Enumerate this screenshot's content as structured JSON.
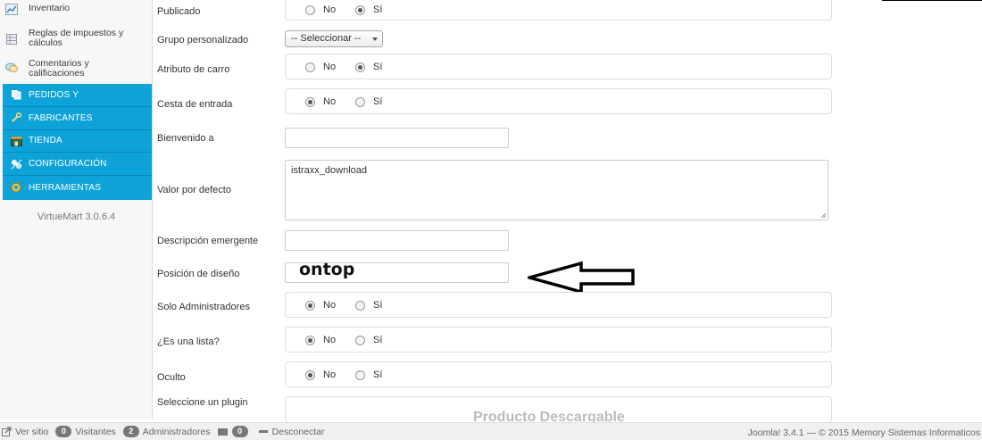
{
  "sidebar": {
    "top_items": [
      {
        "label": "Inventario",
        "icon": "chart-icon"
      },
      {
        "label": "Reglas de impuestos y cálculos",
        "icon": "table-icon"
      },
      {
        "label": "Comentarios y calificaciones",
        "icon": "comment-icon"
      }
    ],
    "menu_items": [
      {
        "label": "PEDIDOS Y",
        "icon": "copy-icon"
      },
      {
        "label": "FABRICANTES",
        "icon": "wrench-icon"
      },
      {
        "label": "TIENDA",
        "icon": "store-icon"
      },
      {
        "label": "CONFIGURACIÓN",
        "icon": "config-icon"
      },
      {
        "label": "HERRAMIENTAS",
        "icon": "tools-icon"
      }
    ],
    "version": "VirtueMart 3.0.6.4",
    "accent_color": "#0ea3d8"
  },
  "form": {
    "publicado": {
      "label": "Publicado",
      "no": "No",
      "si": "Sí",
      "selected": "si"
    },
    "grupo": {
      "label": "Grupo personalizado",
      "select_value": "-- Seleccionar --"
    },
    "atributo": {
      "label": "Atributo de carro",
      "no": "No",
      "si": "Sí",
      "selected": "si"
    },
    "cesta": {
      "label": "Cesta de entrada",
      "no": "No",
      "si": "Sí",
      "selected": "no"
    },
    "bienvenido": {
      "label": "Bienvenido a",
      "value": ""
    },
    "valor": {
      "label": "Valor por defecto",
      "value": "istraxx_download"
    },
    "descripcion": {
      "label": "Descripción emergente",
      "value": ""
    },
    "posicion": {
      "label": "Posición de diseño",
      "value": "ontop"
    },
    "solo_admin": {
      "label": "Solo Administradores",
      "no": "No",
      "si": "Sí",
      "selected": "no"
    },
    "es_lista": {
      "label": "¿Es una lista?",
      "no": "No",
      "si": "Sí",
      "selected": "no"
    },
    "oculto": {
      "label": "Oculto",
      "no": "No",
      "si": "Sí",
      "selected": "no"
    },
    "plugin": {
      "label": "Seleccione un plugin",
      "heading": "Producto Descargable"
    }
  },
  "statusbar": {
    "ver_sitio": "Ver sitio",
    "visitantes_count": "0",
    "visitantes": "Visitantes",
    "admins_count": "2",
    "administradores": "Administradores",
    "messages_count": "0",
    "desconectar": "Desconectar",
    "footer": "Joomla! 3.4.1 — © 2015 Memory Sistemas Informaticos"
  }
}
